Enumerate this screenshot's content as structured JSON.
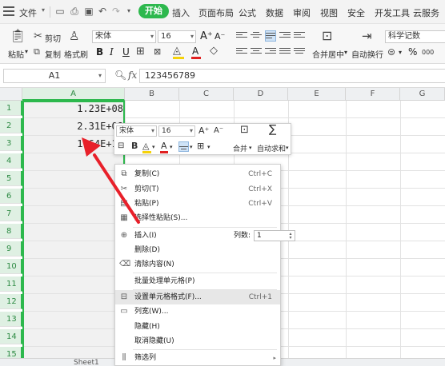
{
  "menubar": {
    "file_label": "文件",
    "tabs": [
      {
        "label": "开始",
        "active": true
      },
      {
        "label": "插入"
      },
      {
        "label": "页面布局"
      },
      {
        "label": "公式"
      },
      {
        "label": "数据"
      },
      {
        "label": "审阅"
      },
      {
        "label": "视图"
      },
      {
        "label": "安全"
      },
      {
        "label": "开发工具"
      },
      {
        "label": "云服务"
      }
    ],
    "accent_color": "#2db84d"
  },
  "ribbon": {
    "paste_label": "粘贴",
    "cut_label": "剪切",
    "copy_label": "复制",
    "format_painter_label": "格式刷",
    "font_name": "宋体",
    "font_size": "16",
    "merge_center_label": "合并居中",
    "wrap_text_label": "自动换行",
    "number_format": "科学记数",
    "percent_symbol": "%",
    "thousands_symbol": "000"
  },
  "formula_bar": {
    "cell_ref": "A1",
    "fx_label": "fx",
    "value": "123456789"
  },
  "grid": {
    "columns": [
      "A",
      "B",
      "C",
      "D",
      "E",
      "F",
      "G"
    ],
    "rows": [
      "1",
      "2",
      "3",
      "4",
      "5",
      "6",
      "7",
      "8",
      "9",
      "10",
      "11",
      "12",
      "13",
      "14",
      "15"
    ],
    "cells": [
      {
        "row": "1",
        "value": "1.23E+08"
      },
      {
        "row": "2",
        "value": "2.31E+08"
      },
      {
        "row": "3",
        "value": "1.64E+10"
      }
    ],
    "selected_column": "A",
    "sheet_tab": "Sheet1"
  },
  "mini_toolbar": {
    "font_name": "宋体",
    "font_size": "16",
    "merge_label": "合并",
    "autosum_label": "自动求和"
  },
  "context_menu": {
    "items": [
      {
        "icon": "copy-icon",
        "label": "复制(C)",
        "shortcut": "Ctrl+C"
      },
      {
        "icon": "cut-icon",
        "label": "剪切(T)",
        "shortcut": "Ctrl+X"
      },
      {
        "icon": "paste-icon",
        "label": "粘贴(P)",
        "shortcut": "Ctrl+V"
      },
      {
        "icon": "paste-special-icon",
        "label": "选择性粘贴(S)..."
      },
      {
        "icon": "insert-icon",
        "label": "插入(I)",
        "columns_label": "列数:",
        "columns_value": "1"
      },
      {
        "icon": "",
        "label": "删除(D)"
      },
      {
        "icon": "clear-icon",
        "label": "清除内容(N)"
      },
      {
        "icon": "",
        "label": "批量处理单元格(P)"
      },
      {
        "icon": "format-cells-icon",
        "label": "设置单元格格式(F)...",
        "shortcut": "Ctrl+1",
        "highlighted": true
      },
      {
        "icon": "column-width-icon",
        "label": "列宽(W)..."
      },
      {
        "icon": "",
        "label": "隐藏(H)"
      },
      {
        "icon": "",
        "label": "取消隐藏(U)"
      },
      {
        "icon": "filter-column-icon",
        "label": "筛选列",
        "submenu": true
      }
    ]
  }
}
